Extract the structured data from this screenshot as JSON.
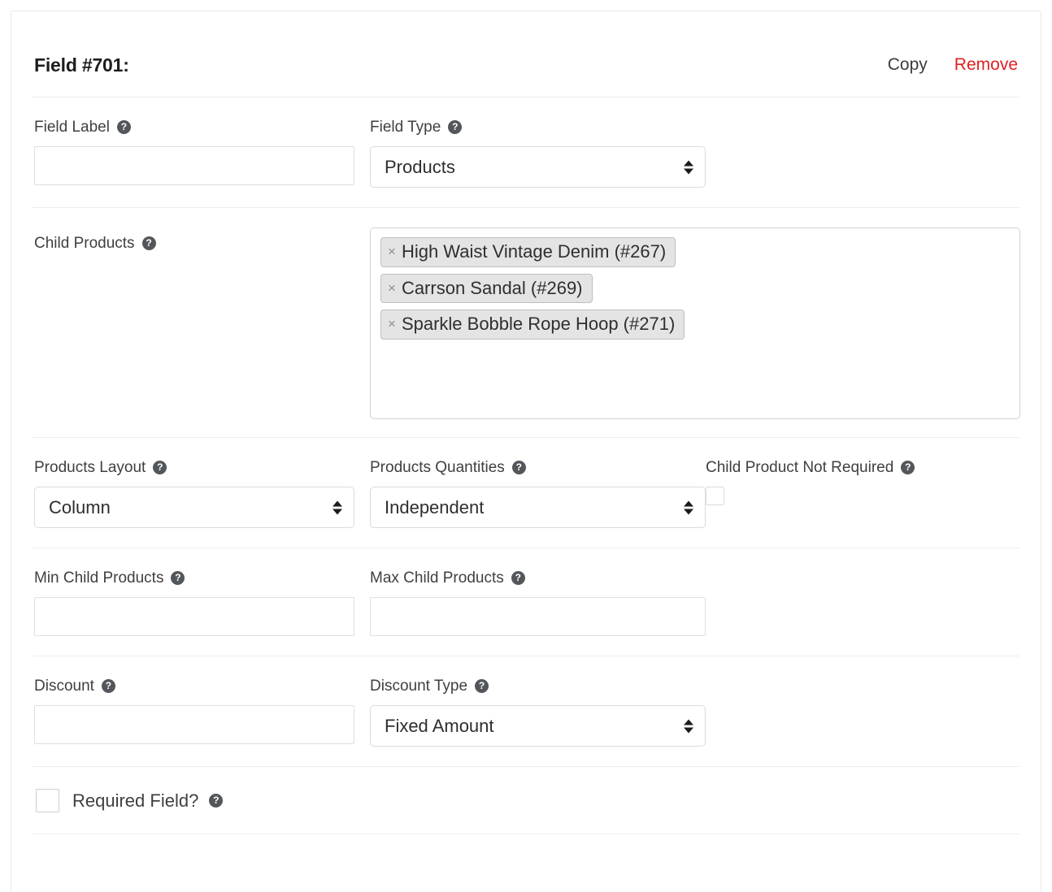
{
  "header": {
    "title": "Field #701:",
    "copy_label": "Copy",
    "remove_label": "Remove"
  },
  "colors": {
    "remove_link": "#e02121",
    "copy_link": "#3c3c3c",
    "help_icon_bg": "#53575b",
    "tag_bg": "#e4e4e4"
  },
  "icons": {
    "help": "?",
    "tag_remove": "×"
  },
  "fields": {
    "field_label": {
      "label": "Field Label",
      "value": "",
      "placeholder": ""
    },
    "field_type": {
      "label": "Field Type",
      "value": "Products"
    },
    "child_products": {
      "label": "Child Products",
      "tags": [
        "High Waist Vintage Denim (#267)",
        "Carrson Sandal (#269)",
        "Sparkle Bobble Rope Hoop (#271)"
      ]
    },
    "products_layout": {
      "label": "Products Layout",
      "value": "Column"
    },
    "products_quantities": {
      "label": "Products Quantities",
      "value": "Independent"
    },
    "child_product_not_required": {
      "label": "Child Product Not Required",
      "checked": false
    },
    "min_child_products": {
      "label": "Min Child Products",
      "value": "",
      "placeholder": ""
    },
    "max_child_products": {
      "label": "Max Child Products",
      "value": "",
      "placeholder": ""
    },
    "discount": {
      "label": "Discount",
      "value": "",
      "placeholder": ""
    },
    "discount_type": {
      "label": "Discount Type",
      "value": "Fixed Amount"
    },
    "required_field": {
      "label": "Required Field?",
      "checked": false
    }
  }
}
